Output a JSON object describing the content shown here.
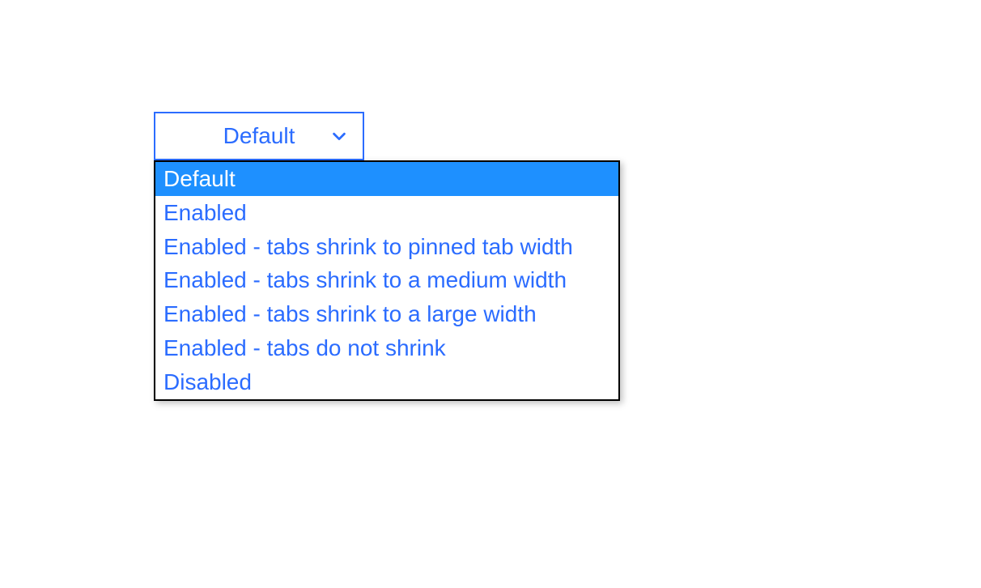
{
  "dropdown": {
    "selected_value": "Default",
    "options": [
      {
        "label": "Default",
        "selected": true
      },
      {
        "label": "Enabled",
        "selected": false
      },
      {
        "label": "Enabled - tabs shrink to pinned tab width",
        "selected": false
      },
      {
        "label": "Enabled - tabs shrink to a medium width",
        "selected": false
      },
      {
        "label": "Enabled - tabs shrink to a large width",
        "selected": false
      },
      {
        "label": "Enabled - tabs do not shrink",
        "selected": false
      },
      {
        "label": "Disabled",
        "selected": false
      }
    ]
  },
  "colors": {
    "accent": "#2b6cff",
    "highlight": "#1e90ff",
    "border": "#000000"
  }
}
